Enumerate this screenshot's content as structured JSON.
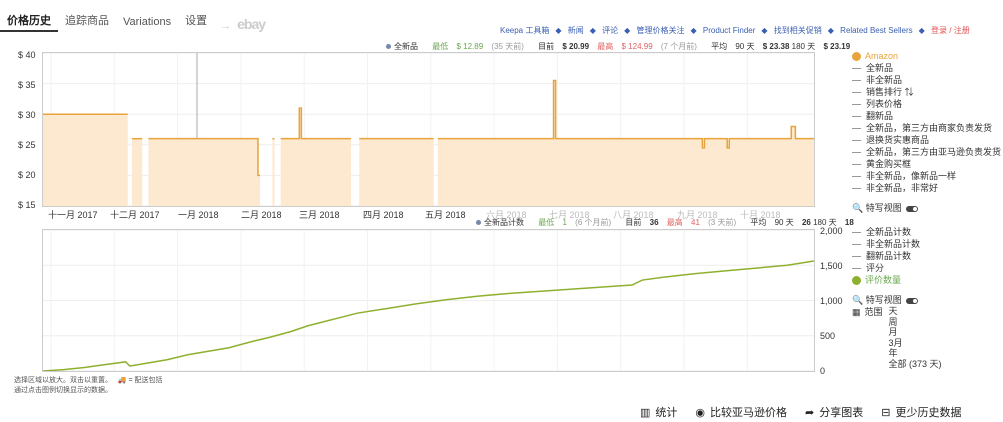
{
  "tabs": [
    {
      "label": "价格历史",
      "active": true
    },
    {
      "label": "追踪商品",
      "active": false
    },
    {
      "label": "Variations",
      "active": false
    },
    {
      "label": "设置",
      "active": false
    }
  ],
  "tab_arrow": "→",
  "tab_ebay": "ebay",
  "top_links": {
    "items": [
      "Keepa 工具箱",
      "新闻",
      "评论",
      "管理价格关注",
      "Product Finder",
      "找到相关促销",
      "Related Best Sellers"
    ],
    "login": "登录 / 注册"
  },
  "price_legend": {
    "series": "全新品",
    "low_label": "最低",
    "low_value": "$ 12.89",
    "low_when": "(35 天前)",
    "current_label": "目前",
    "current_value": "$ 20.99",
    "high_label": "最高",
    "high_value": "$ 124.99",
    "high_when": "(7 个月前)",
    "avg_label": "平均",
    "avg90_label": "90 天",
    "avg90_value": "$ 23.38",
    "avg180_label": "180 天",
    "avg180_value": "$ 23.19"
  },
  "count_legend": {
    "series": "全新品计数",
    "low_label": "最低",
    "low_value": "1",
    "low_when": "(6 个月前)",
    "current_label": "目前",
    "current_value": "36",
    "high_label": "最高",
    "high_value": "41",
    "high_when": "(3 天前)",
    "avg_label": "平均",
    "avg90_label": "90 天",
    "avg90_value": "26",
    "avg180_label": "180 天",
    "avg180_value": "18"
  },
  "price_side": {
    "amazon": "Amazon",
    "items": [
      "全新品",
      "非全新品",
      "销售排行 ⇅",
      "列表价格",
      "翻新品",
      "全新品，第三方由商家负责发货",
      "退换货实惠商品",
      "全新品，第三方由亚马逊负责发货",
      "黄金购买框",
      "非全新品，像新品一样",
      "非全新品，非常好"
    ],
    "special_view": "特写视图"
  },
  "count_side": {
    "items": [
      "全新品计数",
      "非全新品计数",
      "翻新品计数",
      "评分"
    ],
    "reviews": "评价数量",
    "special_view": "特写视图",
    "range_label": "范围",
    "range_options": [
      "天",
      "周",
      "月",
      "3月",
      "年",
      "全部 (373 天)"
    ]
  },
  "note": {
    "line1": "选择区域以放大。双击以重置。",
    "shipping": "= 配送包括",
    "line2": "通过点击图例切换显示的数据。"
  },
  "bottom_buttons": {
    "stats": "统计",
    "compare": "比较亚马逊价格",
    "share": "分享图表",
    "less": "更少历史数据"
  },
  "colors": {
    "price": "#e8a33a",
    "price_fill": "#fde9cf",
    "reviews": "#8db02e"
  },
  "chart_data": [
    {
      "type": "area",
      "title": "",
      "ylabel": "",
      "yticks": [
        "$ 40",
        "$ 35",
        "$ 30",
        "$ 25",
        "$ 20",
        "$ 15"
      ],
      "ylim": [
        15,
        40
      ],
      "xticks": [
        "十一月 2017",
        "十二月 2017",
        "一月 2018",
        "二月 2018",
        "三月 2018",
        "四月 2018",
        "五月 2018",
        "六月 2018",
        "七月 2018",
        "八月 2018",
        "九月 2018",
        "十月 2018"
      ],
      "x_range_days": [
        0,
        373
      ],
      "series": [
        {
          "name": "全新品",
          "segments": [
            [
              [
                0,
                30
              ],
              [
                41,
                30
              ]
            ],
            [
              [
                43,
                26
              ],
              [
                48,
                26
              ]
            ],
            [
              [
                51,
                26
              ],
              [
                104,
                26
              ],
              [
                104,
                20
              ],
              [
                105,
                20
              ]
            ],
            [
              [
                111,
                26
              ],
              [
                112,
                26
              ]
            ],
            [
              [
                115,
                26
              ],
              [
                124,
                26
              ],
              [
                124,
                31
              ],
              [
                125,
                31
              ],
              [
                125,
                26
              ],
              [
                149,
                26
              ]
            ],
            [
              [
                153,
                26
              ],
              [
                189,
                26
              ]
            ],
            [
              [
                191,
                26
              ],
              [
                247,
                26
              ],
              [
                247,
                35.5
              ],
              [
                248,
                35.5
              ],
              [
                248,
                26
              ],
              [
                319,
                26
              ],
              [
                319,
                24.5
              ],
              [
                320,
                24.5
              ],
              [
                320,
                26
              ],
              [
                331,
                26
              ],
              [
                331,
                24.5
              ],
              [
                332,
                24.5
              ],
              [
                332,
                26
              ],
              [
                362,
                26
              ],
              [
                362,
                28
              ],
              [
                364,
                28
              ],
              [
                364,
                26
              ],
              [
                373,
                26
              ]
            ]
          ]
        }
      ]
    },
    {
      "type": "line",
      "title": "",
      "ylabel": "",
      "yticks": [
        "2,000",
        "1,500",
        "1,000",
        "500",
        "0"
      ],
      "ylim": [
        0,
        2000
      ],
      "x_range_days": [
        0,
        373
      ],
      "series": [
        {
          "name": "评价数量",
          "points": [
            [
              0,
              0
            ],
            [
              10,
              20
            ],
            [
              20,
              50
            ],
            [
              30,
              90
            ],
            [
              40,
              130
            ],
            [
              42,
              70
            ],
            [
              50,
              110
            ],
            [
              60,
              160
            ],
            [
              70,
              230
            ],
            [
              80,
              280
            ],
            [
              90,
              330
            ],
            [
              100,
              410
            ],
            [
              110,
              480
            ],
            [
              120,
              560
            ],
            [
              128,
              640
            ],
            [
              136,
              700
            ],
            [
              144,
              760
            ],
            [
              152,
              820
            ],
            [
              165,
              880
            ],
            [
              180,
              950
            ],
            [
              195,
              1010
            ],
            [
              210,
              1060
            ],
            [
              225,
              1100
            ],
            [
              240,
              1130
            ],
            [
              255,
              1160
            ],
            [
              270,
              1190
            ],
            [
              285,
              1220
            ],
            [
              290,
              1290
            ],
            [
              300,
              1330
            ],
            [
              315,
              1380
            ],
            [
              330,
              1420
            ],
            [
              345,
              1460
            ],
            [
              360,
              1500
            ],
            [
              373,
              1560
            ]
          ]
        }
      ]
    }
  ]
}
